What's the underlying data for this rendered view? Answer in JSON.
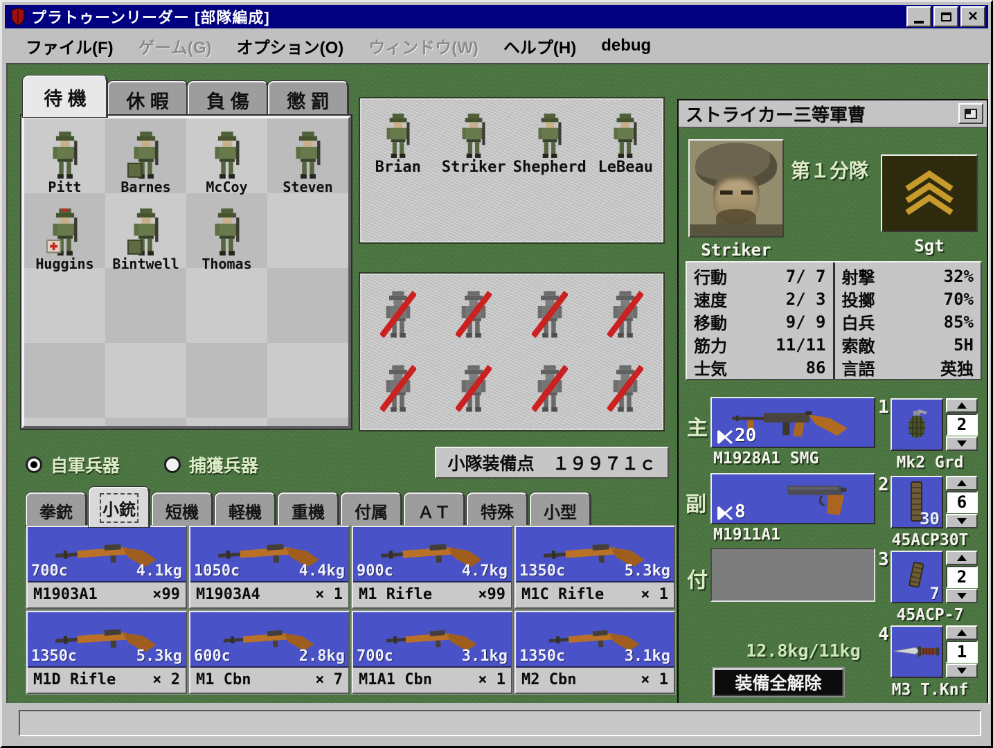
{
  "window": {
    "title": "プラトゥーンリーダー [部隊編成]"
  },
  "menu": {
    "items": [
      {
        "label": "ファイル(F)",
        "enabled": true
      },
      {
        "label": "ゲーム(G)",
        "enabled": false
      },
      {
        "label": "オプション(O)",
        "enabled": true
      },
      {
        "label": "ウィンドウ(W)",
        "enabled": false
      },
      {
        "label": "ヘルプ(H)",
        "enabled": true
      },
      {
        "label": "debug",
        "enabled": true
      }
    ]
  },
  "roster": {
    "tabs": [
      {
        "label": "待 機"
      },
      {
        "label": "休 暇"
      },
      {
        "label": "負 傷"
      },
      {
        "label": "懲 罰"
      }
    ],
    "soldiers": [
      {
        "name": "Pitt"
      },
      {
        "name": "Barnes"
      },
      {
        "name": "McCoy"
      },
      {
        "name": "Steven"
      },
      {
        "name": "Huggins"
      },
      {
        "name": "Bintwell"
      },
      {
        "name": "Thomas"
      }
    ]
  },
  "squad": {
    "members": [
      {
        "name": "Brian"
      },
      {
        "name": "Striker"
      },
      {
        "name": "Shepherd"
      },
      {
        "name": "LeBeau"
      }
    ],
    "empty_slot_count": 8
  },
  "filter": {
    "own": "自軍兵器",
    "captured": "捕獲兵器",
    "points_label": "小隊装備点",
    "points_value": "１９９７１ｃ"
  },
  "weapon_tabs": [
    {
      "label": "拳銃"
    },
    {
      "label": "小銃"
    },
    {
      "label": "短機"
    },
    {
      "label": "軽機"
    },
    {
      "label": "重機"
    },
    {
      "label": "付属"
    },
    {
      "label": "ＡＴ"
    },
    {
      "label": "特殊"
    },
    {
      "label": "小型"
    }
  ],
  "weapon_cards": [
    {
      "cost": "700c",
      "weight": "4.1kg",
      "name": "M1903A1",
      "count": "×99"
    },
    {
      "cost": "1050c",
      "weight": "4.4kg",
      "name": "M1903A4",
      "count": "× 1"
    },
    {
      "cost": "900c",
      "weight": "4.7kg",
      "name": "M1 Rifle",
      "count": "×99"
    },
    {
      "cost": "1350c",
      "weight": "5.3kg",
      "name": "M1C Rifle",
      "count": "× 1"
    },
    {
      "cost": "1350c",
      "weight": "5.3kg",
      "name": "M1D Rifle",
      "count": "× 2"
    },
    {
      "cost": "600c",
      "weight": "2.8kg",
      "name": "M1 Cbn",
      "count": "× 7"
    },
    {
      "cost": "700c",
      "weight": "3.1kg",
      "name": "M1A1 Cbn",
      "count": "× 1"
    },
    {
      "cost": "1350c",
      "weight": "3.1kg",
      "name": "M2 Cbn",
      "count": "× 1"
    }
  ],
  "soldier_panel": {
    "header": "ストライカー三等軍曹",
    "name": "Striker",
    "unit": "第１分隊",
    "rank": "Sgt",
    "stats_left": [
      {
        "label": "行動",
        "value": "7/ 7"
      },
      {
        "label": "速度",
        "value": "2/ 3"
      },
      {
        "label": "移動",
        "value": "9/ 9"
      },
      {
        "label": "筋力",
        "value": "11/11"
      },
      {
        "label": "士気",
        "value": "86"
      }
    ],
    "stats_right": [
      {
        "label": "射撃",
        "value": "32%"
      },
      {
        "label": "投擲",
        "value": "70%"
      },
      {
        "label": "白兵",
        "value": "85%"
      },
      {
        "label": "索敵",
        "value": "5H"
      },
      {
        "label": "言語",
        "value": "英独"
      }
    ],
    "slots": [
      {
        "label": "主",
        "name": "M1928A1 SMG",
        "ammo": "20"
      },
      {
        "label": "副",
        "name": "M1911A1",
        "ammo": "8"
      },
      {
        "label": "付",
        "name": ""
      }
    ],
    "items": [
      {
        "num": "1",
        "name": "Mk2 Grd",
        "qty": "2"
      },
      {
        "num": "2",
        "name": "45ACP30T",
        "qty": "6",
        "badge": "30"
      },
      {
        "num": "3",
        "name": "45ACP-7",
        "qty": "2",
        "badge": "7"
      },
      {
        "num": "4",
        "name": "M3 T.Knf",
        "qty": "1"
      }
    ],
    "weight": "12.8kg/11kg",
    "unequip_all": "装備全解除"
  }
}
